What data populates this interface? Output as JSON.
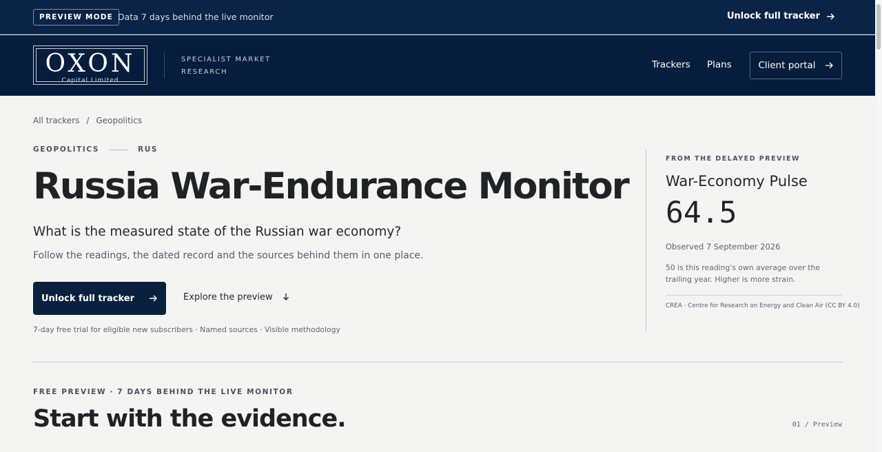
{
  "topbar": {
    "badge": "PREVIEW MODE",
    "note": "Data 7 days behind the live monitor",
    "unlock_label": "Unlock full tracker"
  },
  "header": {
    "logo_name": "OXON",
    "logo_subtitle": "Capital Limited",
    "tagline": "SPECIALIST MARKET RESEARCH",
    "nav": [
      "Trackers",
      "Plans"
    ],
    "portal_label": "Client portal"
  },
  "breadcrumb": [
    "All trackers",
    "/",
    "Geopolitics"
  ],
  "hero": {
    "category": "GEOPOLITICS",
    "country": "RUS",
    "title": "Russia War-Endurance Monitor",
    "question": "What is the measured state of the Russian war economy?",
    "lead": "Follow the readings, the dated record and the sources behind them in one place.",
    "primary_label": "Unlock full tracker",
    "secondary_label": "Explore the preview",
    "fine_print": "7-day free trial for eligible new subscribers · Named sources · Visible methodology"
  },
  "pulse": {
    "eyebrow": "FROM THE DELAYED PREVIEW",
    "title": "War-Economy Pulse",
    "value": "64.5",
    "observed": "Observed 7 September 2026",
    "note": "50 is this reading's own average over the trailing year. Higher is more strain.",
    "source": "CREA · Centre for Research on Energy and Clean Air (CC BY 4.0)"
  },
  "preview": {
    "label": "FREE PREVIEW · 7 DAYS BEHIND THE LIVE MONITOR",
    "title": "Start with the evidence.",
    "index": "01 / Preview"
  },
  "colors": {
    "navy": "#071d3d",
    "topbar": "#0b2347",
    "page_background": "#f4f4f2"
  },
  "icons": {
    "arrow_right": "arrow-right-icon",
    "arrow_down": "arrow-down-icon"
  }
}
